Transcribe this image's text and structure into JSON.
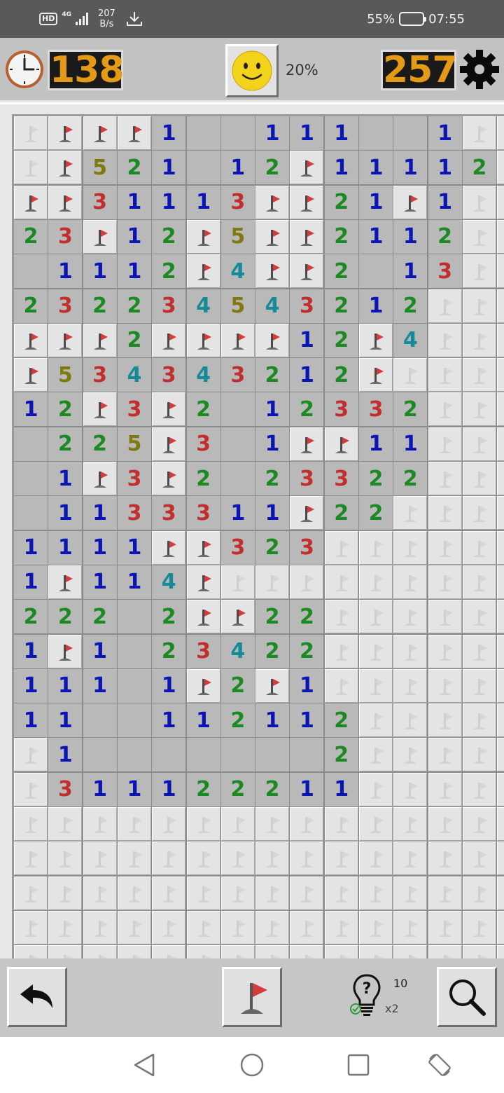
{
  "status_bar": {
    "hd_label": "HD",
    "network_label": "4G",
    "speed_value": "207",
    "speed_unit": "B/s",
    "battery_percent": "55%",
    "battery_level": 0.55,
    "time": "07:55"
  },
  "game_header": {
    "timer_value": "138",
    "progress": "20%",
    "mines_remaining": "257",
    "face_state": "smile"
  },
  "colors": {
    "counter_digits": "#e49a17",
    "counter_bg": "#1a1a1a",
    "number_1": "#0b15b4",
    "number_2": "#1c8a22",
    "number_3": "#c22d2d",
    "number_4": "#178a98",
    "number_5": "#807a0e",
    "flag": "#d23c3c"
  },
  "board": {
    "legend": "C = closed cell, F = flagged cell, . = opened empty cell, digit = opened number",
    "rows": [
      "CFFF1..111..1CC",
      "CF521.12F11112C",
      "FF31113FF21F1CC",
      "23F12F5FF2112CC",
      ".1112F4FF2.13CC",
      "232234543212CCC",
      "FFF2FFFF12F4CCC",
      "F53434321_2FCCC",
      "12F3F2.12332CCC",
      ".225F3.1FF11CCC",
      ".1F3F2.23322CCC",
      ".113331 1F22CCC",
      "1111FF323CCCCCC",
      "1F114FCCCCCCCCC",
      "222.2FF22CCCCCC",
      "1F1.23422CCCCCC",
      "111.1F2F1CCCCCC",
      "11..11211 2CCCCC",
      "C1.......2CCCCC",
      "C31112221 1CCCCC",
      "CCCCCCCCCCCCCCC",
      "CCCCCCCCCCCCCCC",
      "CCCCCCCCCCCCCCC",
      "CCCCCCCCCCCCCCC",
      "CCCCCCCCCCCCCCC"
    ]
  },
  "bottom_bar": {
    "hints_available": "10",
    "hint_multiplier": "x2"
  },
  "icons": {
    "clock": "clock-icon",
    "smiley": "smiley-face-icon",
    "gear": "gear-icon",
    "undo": "undo-arrow-icon",
    "flag_tool": "flag-tool-icon",
    "hint": "lightbulb-question-icon",
    "search": "magnifier-icon",
    "nav_back": "nav-back-icon",
    "nav_home": "nav-home-icon",
    "nav_recents": "nav-recents-icon",
    "nav_rotate": "rotate-screen-icon"
  }
}
